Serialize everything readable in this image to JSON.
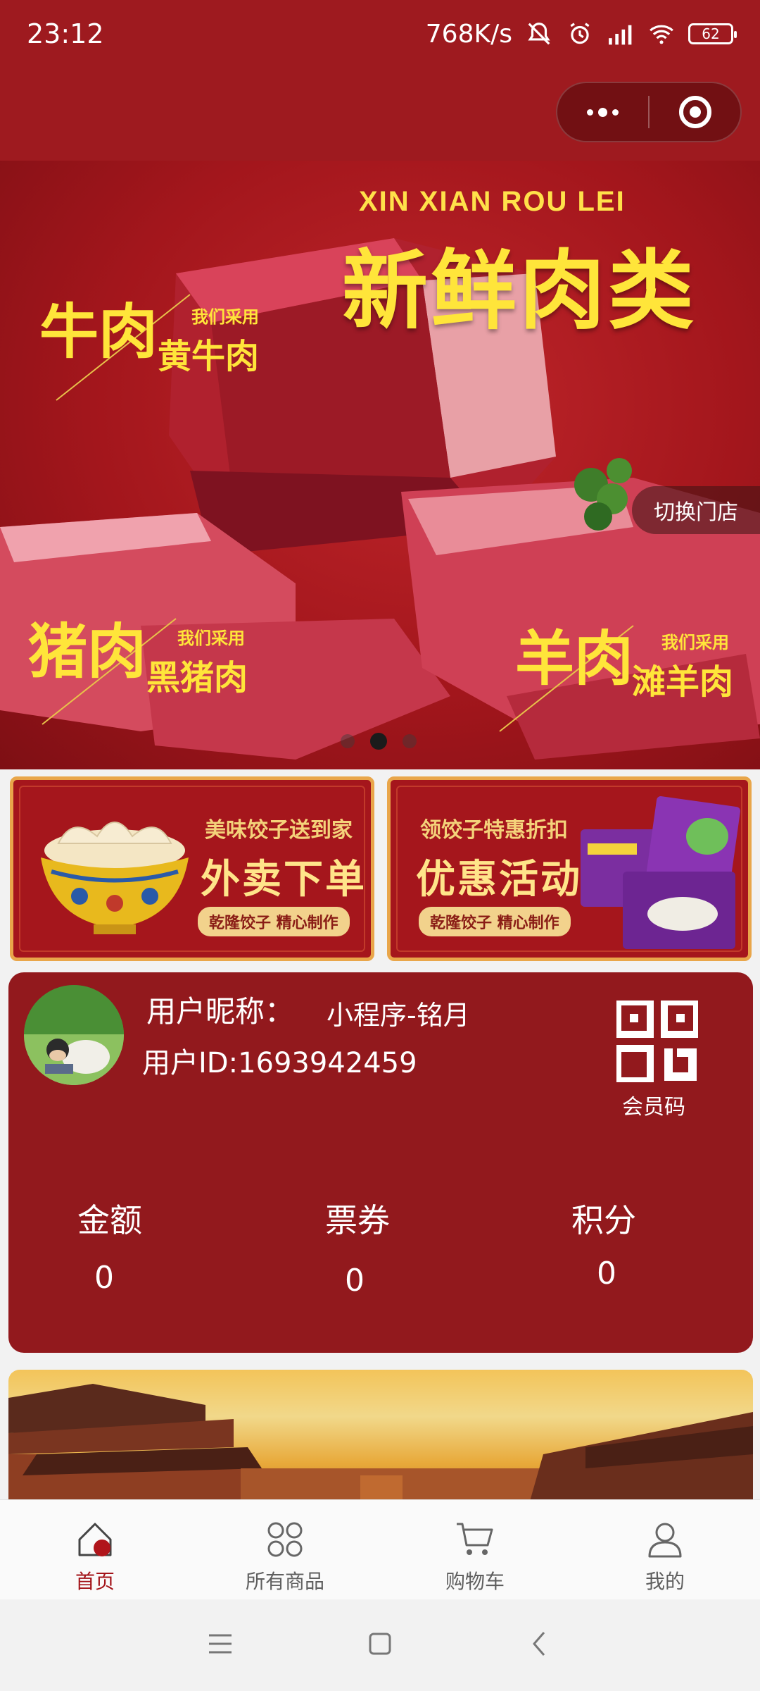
{
  "status_bar": {
    "time": "23:12",
    "network_speed": "768K/s",
    "battery": "62"
  },
  "banner": {
    "pinyin": "XIN    XIAN    ROU    LEI",
    "headline": "新鲜肉类",
    "beef_big": "牛肉",
    "beef_small": "我们采用",
    "beef_mid": "黄牛肉",
    "pork_big": "猪肉",
    "pork_small": "我们采用",
    "pork_mid": "黑猪肉",
    "lamb_big": "羊肉",
    "lamb_small": "我们采用",
    "lamb_mid": "滩羊肉",
    "switch_store": "切换门店",
    "pager_count": 3,
    "pager_active_index": 1
  },
  "promos": [
    {
      "title": "美味饺子送到家",
      "big": "外卖下单",
      "tag": "乾隆饺子  精心制作"
    },
    {
      "title": "领饺子特惠折扣",
      "big": "优惠活动",
      "tag": "乾隆饺子  精心制作"
    }
  ],
  "member": {
    "nickname_label": "用户昵称：",
    "nickname": "小程序-铭月",
    "user_id": "用户ID:1693942459",
    "qr_label": "会员码",
    "stats": [
      {
        "label": "金额",
        "value": "0"
      },
      {
        "label": "票券",
        "value": "0"
      },
      {
        "label": "积分",
        "value": "0"
      }
    ]
  },
  "tabs": [
    {
      "label": "首页",
      "icon": "home-icon",
      "active": true
    },
    {
      "label": "所有商品",
      "icon": "grid-icon",
      "active": false
    },
    {
      "label": "购物车",
      "icon": "cart-icon",
      "active": false
    },
    {
      "label": "我的",
      "icon": "user-icon",
      "active": false
    }
  ],
  "colors": {
    "primary_red": "#9e1a1f",
    "card_red": "#92191d",
    "gold": "#ffe53a",
    "active_tab": "#a3141a"
  }
}
